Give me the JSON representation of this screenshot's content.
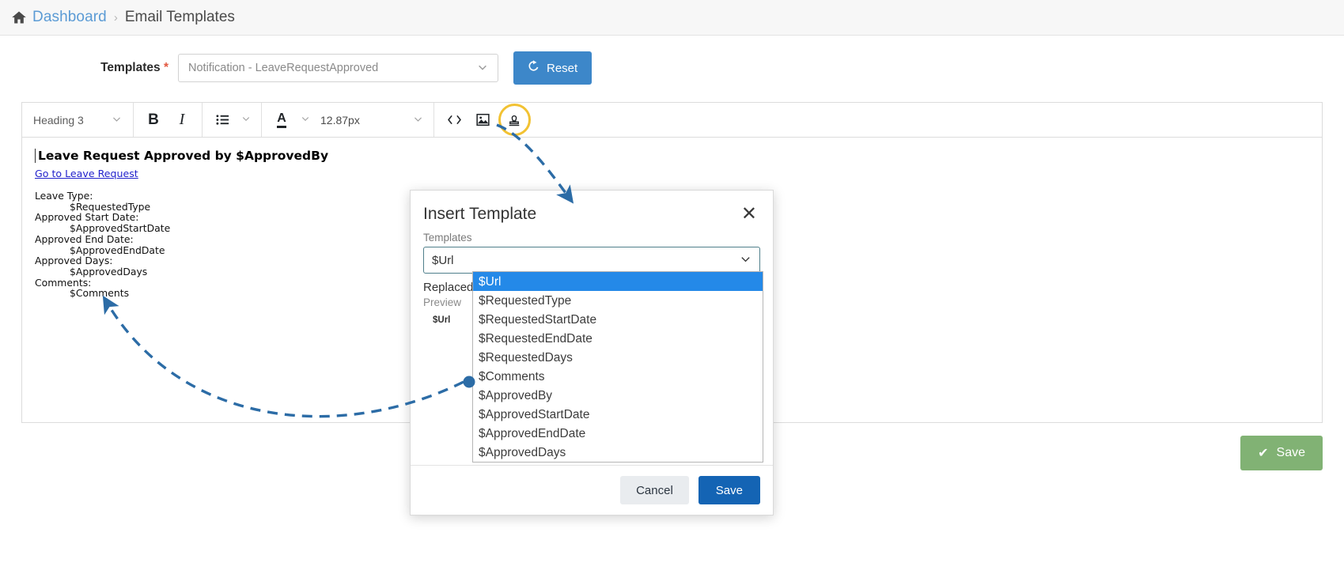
{
  "breadcrumb": {
    "home_icon": "home-icon",
    "link": "Dashboard",
    "separator": "›",
    "current": "Email Templates"
  },
  "template_selector": {
    "label": "Templates",
    "required_mark": "*",
    "value": "Notification - LeaveRequestApproved",
    "chevron": "⌄",
    "reset_button": {
      "label": "Reset",
      "icon": "⟳"
    }
  },
  "toolbar": {
    "block_format": "Heading 3",
    "bold": "B",
    "italic": "I",
    "list_icon": "bullet-list-icon",
    "font_color_letter": "A",
    "font_size": "12.87px",
    "code_icon": "<>",
    "image_icon": "image-icon",
    "template_icon": "stamp-icon",
    "chevron": "⌄"
  },
  "editor_body": {
    "heading": "Leave Request Approved by $ApprovedBy",
    "link": "Go to Leave Request",
    "fields": [
      {
        "label": "Leave Type:",
        "value": "$RequestedType"
      },
      {
        "label": "Approved Start Date:",
        "value": "$ApprovedStartDate"
      },
      {
        "label": "Approved End Date:",
        "value": "$ApprovedEndDate"
      },
      {
        "label": "Approved Days:",
        "value": "$ApprovedDays"
      },
      {
        "label": "Comments:",
        "value": "$Comments"
      }
    ]
  },
  "page_actions": {
    "save_label": "Save",
    "save_icon": "✔"
  },
  "modal": {
    "title": "Insert Template",
    "close_icon": "✕",
    "field_label": "Templates",
    "selected_value": "$Url",
    "chevron": "⌄",
    "replaced_label": "Replaced",
    "preview_label": "Preview",
    "preview_value": "$Url",
    "options": [
      "$Url",
      "$RequestedType",
      "$RequestedStartDate",
      "$RequestedEndDate",
      "$RequestedDays",
      "$Comments",
      "$ApprovedBy",
      "$ApprovedStartDate",
      "$ApprovedEndDate",
      "$ApprovedDays"
    ],
    "selected_index": 0,
    "cancel_label": "Cancel",
    "save_label": "Save"
  },
  "annotation": {
    "highlight_color": "#f2c233",
    "arrow_color": "#2c6ca6"
  }
}
